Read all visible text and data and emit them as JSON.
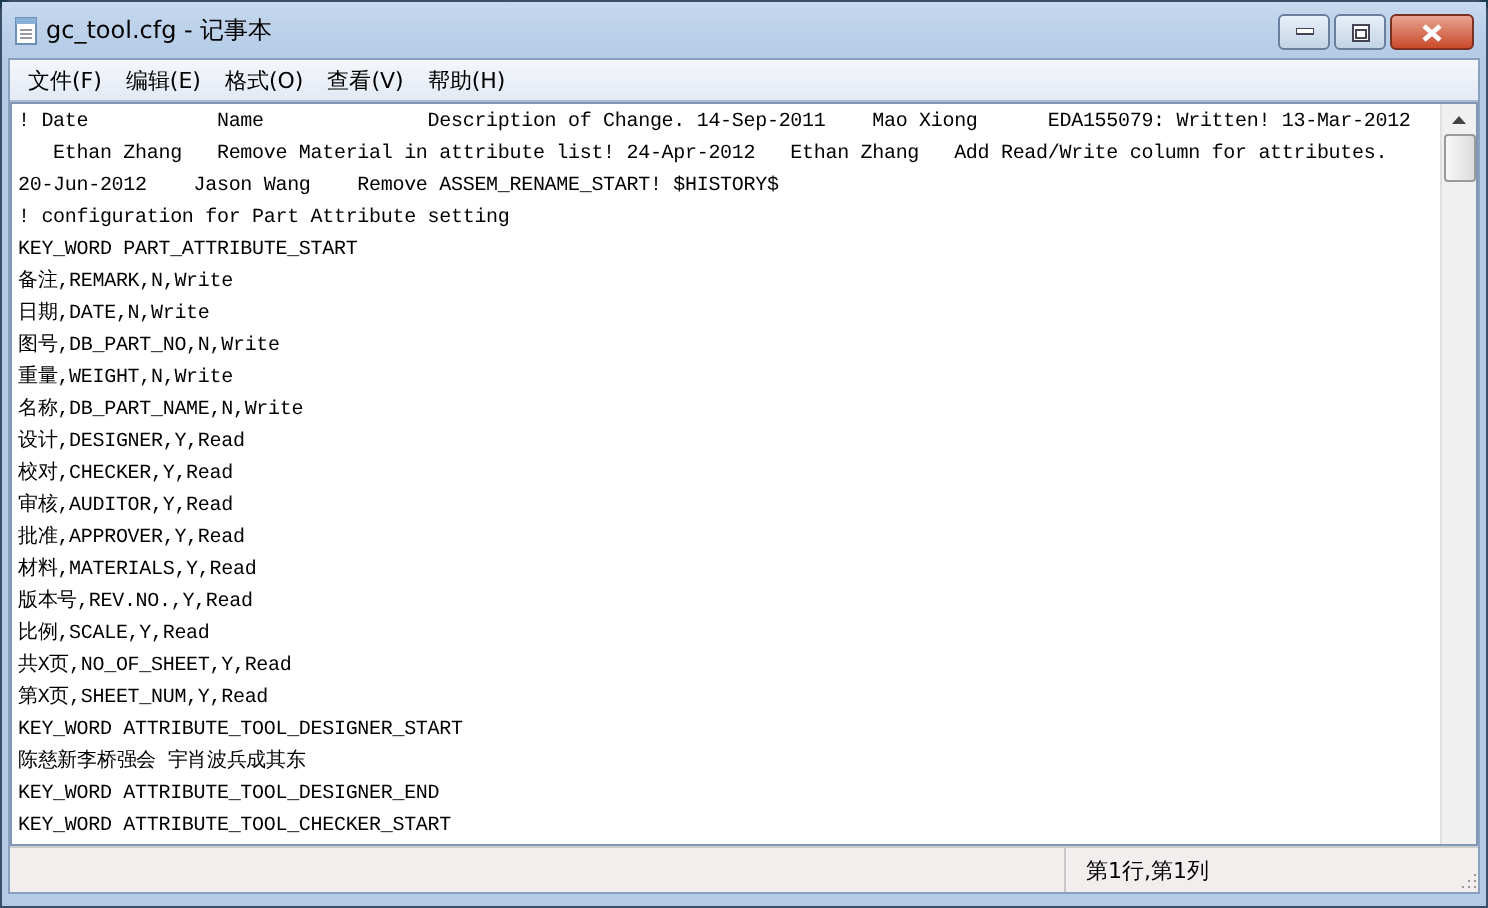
{
  "window": {
    "title": "gc_tool.cfg - 记事本"
  },
  "menu": [
    "文件(F)",
    "编辑(E)",
    "格式(O)",
    "查看(V)",
    "帮助(H)"
  ],
  "editor": {
    "lines": [
      "! Date           Name              Description of Change. 14-Sep-2011    Mao Xiong      EDA155079: Written! 13-Mar-2012",
      "   Ethan Zhang   Remove Material in attribute list! 24-Apr-2012   Ethan Zhang   Add Read/Write column for attributes.",
      "20-Jun-2012    Jason Wang    Remove ASSEM_RENAME_START! $HISTORY$",
      "! configuration for Part Attribute setting",
      "KEY_WORD PART_ATTRIBUTE_START",
      "备注,REMARK,N,Write",
      "日期,DATE,N,Write",
      "图号,DB_PART_NO,N,Write",
      "重量,WEIGHT,N,Write",
      "名称,DB_PART_NAME,N,Write",
      "设计,DESIGNER,Y,Read",
      "校对,CHECKER,Y,Read",
      "审核,AUDITOR,Y,Read",
      "批准,APPROVER,Y,Read",
      "材料,MATERIALS,Y,Read",
      "版本号,REV.NO.,Y,Read",
      "比例,SCALE,Y,Read",
      "共X页,NO_OF_SHEET,Y,Read",
      "第X页,SHEET_NUM,Y,Read",
      "KEY_WORD ATTRIBUTE_TOOL_DESIGNER_START",
      "陈慈新李桥强会 宇肖波兵成其东",
      "KEY_WORD ATTRIBUTE_TOOL_DESIGNER_END",
      "KEY_WORD ATTRIBUTE_TOOL_CHECKER_START"
    ]
  },
  "status_bar": {
    "position": "第1行,第1列"
  }
}
